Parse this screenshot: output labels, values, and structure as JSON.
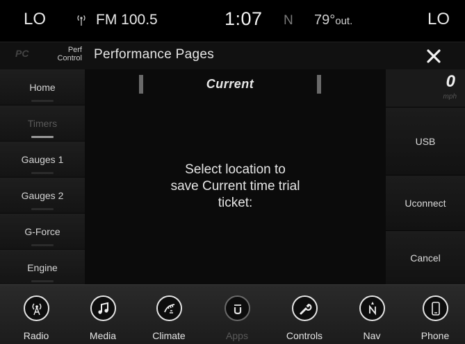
{
  "status_bar": {
    "left_label": "LO",
    "right_label": "LO",
    "station": "FM 100.5",
    "time": "1:07",
    "compass": "N",
    "temperature": "79°",
    "temperature_unit": "out."
  },
  "title_bar": {
    "logo": "PC",
    "section_line1": "Perf",
    "section_line2": "Control",
    "title": "Performance Pages",
    "close_icon": "close-icon"
  },
  "left_nav": {
    "items": [
      {
        "label": "Home",
        "state": "normal"
      },
      {
        "label": "Timers",
        "state": "active-disabled"
      },
      {
        "label": "Gauges 1",
        "state": "normal"
      },
      {
        "label": "Gauges 2",
        "state": "normal"
      },
      {
        "label": "G-Force",
        "state": "normal"
      },
      {
        "label": "Engine",
        "state": "normal"
      }
    ]
  },
  "main": {
    "heading": "Current",
    "message_line1": "Select location to",
    "message_line2": "save Current time trial",
    "message_line3": "ticket:"
  },
  "right_col": {
    "speed_value": "0",
    "speed_unit": "mph",
    "buttons": [
      "USB",
      "Uconnect",
      "Cancel"
    ]
  },
  "dock": {
    "items": [
      {
        "label": "Radio",
        "icon": "radio-icon",
        "enabled": true
      },
      {
        "label": "Media",
        "icon": "music-note-icon",
        "enabled": true
      },
      {
        "label": "Climate",
        "icon": "climate-icon",
        "enabled": true
      },
      {
        "label": "Apps",
        "icon": "apps-icon",
        "enabled": false
      },
      {
        "label": "Controls",
        "icon": "wrench-icon",
        "enabled": true
      },
      {
        "label": "Nav",
        "icon": "compass-icon",
        "enabled": true
      },
      {
        "label": "Phone",
        "icon": "phone-icon",
        "enabled": true
      }
    ]
  },
  "colors": {
    "background": "#000000",
    "text": "#e6e6e6",
    "disabled_text": "#5a5a5a",
    "panel": "#1a1a1a"
  }
}
